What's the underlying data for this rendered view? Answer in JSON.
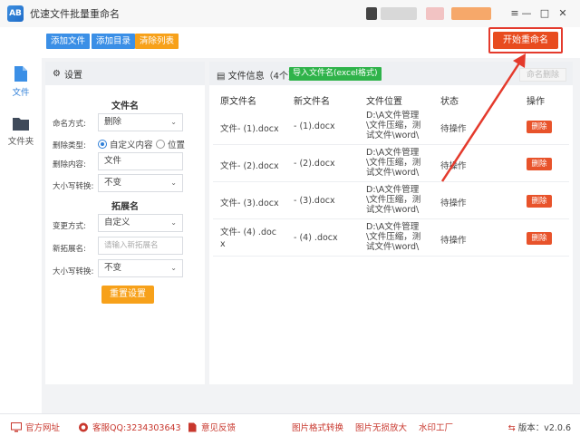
{
  "app": {
    "title": "优速文件批量重命名",
    "logo_text": "AB"
  },
  "window_controls": {
    "menu": "≡",
    "minimize": "—",
    "maximize": "□",
    "close": "✕"
  },
  "toolbar": {
    "add_file": "添加文件",
    "add_folder": "添加目录",
    "clear_list": "清除列表",
    "start_rename": "开始重命名"
  },
  "leftnav": {
    "items": [
      {
        "label": "文件",
        "icon": "file-icon",
        "active": true
      },
      {
        "label": "文件夹",
        "icon": "folder-icon",
        "active": false
      }
    ]
  },
  "settings": {
    "header": "设置",
    "filename_section": "文件名",
    "naming_mode_label": "命名方式:",
    "naming_mode_value": "删除",
    "delete_type_label": "删除类型:",
    "delete_type_options": [
      "自定义内容",
      "位置"
    ],
    "delete_type_selected": "自定义内容",
    "delete_content_label": "删除内容:",
    "delete_content_value": "文件",
    "case_label": "大小写转换:",
    "case_value": "不变",
    "ext_section": "拓展名",
    "change_mode_label": "变更方式:",
    "change_mode_value": "自定义",
    "new_ext_label": "新拓展名:",
    "new_ext_placeholder": "请输入新拓展名",
    "ext_case_label": "大小写转换:",
    "ext_case_value": "不变",
    "reset": "重置设置"
  },
  "filepanel": {
    "title": "文件信息（4个）",
    "import_btn": "导入文件名(excel格式)",
    "delete_name_btn": "命名删除",
    "columns": [
      "原文件名",
      "新文件名",
      "文件位置",
      "状态",
      "操作"
    ],
    "rows": [
      {
        "orig_line1": "文件- (1).docx",
        "orig_line2": "",
        "new": "- (1).docx",
        "loc1": "D:\\A文件管理",
        "loc2": "\\文件压缩，测",
        "loc3": "试文件\\word\\",
        "status": "待操作",
        "action": "删除"
      },
      {
        "orig_line1": "文件- (2).docx",
        "orig_line2": "",
        "new": "- (2).docx",
        "loc1": "D:\\A文件管理",
        "loc2": "\\文件压缩，测",
        "loc3": "试文件\\word\\",
        "status": "待操作",
        "action": "删除"
      },
      {
        "orig_line1": "文件- (3).docx",
        "orig_line2": "",
        "new": "- (3).docx",
        "loc1": "D:\\A文件管理",
        "loc2": "\\文件压缩，测",
        "loc3": "试文件\\word\\",
        "status": "待操作",
        "action": "删除"
      },
      {
        "orig_line1": "文件- (4) .doc",
        "orig_line2": "x",
        "new": "- (4) .docx",
        "loc1": "D:\\A文件管理",
        "loc2": "\\文件压缩，测",
        "loc3": "试文件\\word\\",
        "status": "待操作",
        "action": "删除"
      }
    ]
  },
  "footer": {
    "website": "官方网址",
    "qq": "客服QQ:3234303643",
    "feedback": "意见反馈",
    "img_convert": "图片格式转换",
    "img_enlarge": "图片无损放大",
    "watermark": "水印工厂",
    "version": "版本：v2.0.6"
  },
  "colors": {
    "accent_blue": "#3b8fe6",
    "orange": "#f7a11a",
    "danger": "#e84c1f",
    "green": "#2fb34a",
    "highlight_red": "#e43a2c"
  }
}
